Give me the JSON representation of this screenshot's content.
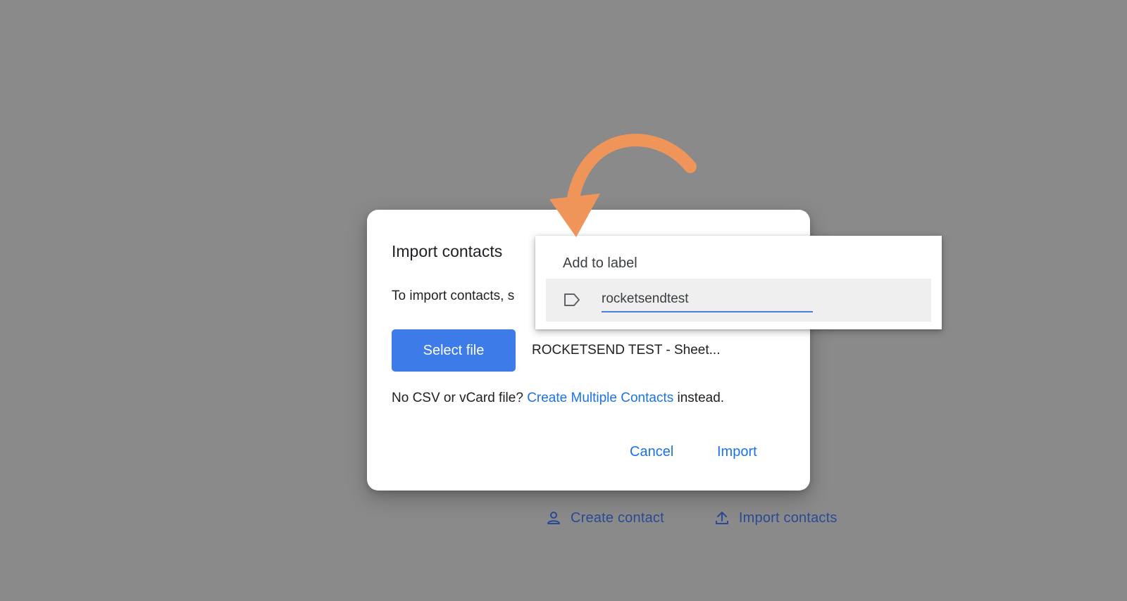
{
  "dialog": {
    "title": "Import contacts",
    "description": "To import contacts, s",
    "select_file_label": "Select file",
    "selected_file_name": "ROCKETSEND TEST - Sheet...",
    "hint_prefix": "No CSV or vCard file? ",
    "hint_link": "Create Multiple Contacts",
    "hint_suffix": " instead.",
    "cancel_label": "Cancel",
    "import_label": "Import"
  },
  "label_menu": {
    "title": "Add to label",
    "input_value": "rocketsendtest",
    "icon": "label-icon"
  },
  "backdrop": {
    "create_contact_label": "Create contact",
    "create_contact_icon": "person-icon",
    "import_contacts_label": "Import contacts",
    "import_contacts_icon": "upload-icon"
  },
  "colors": {
    "backdrop": "#8a8a8a",
    "primary_button": "#3c7be8",
    "link": "#1a73e8",
    "annotation_arrow": "#f0955a"
  }
}
